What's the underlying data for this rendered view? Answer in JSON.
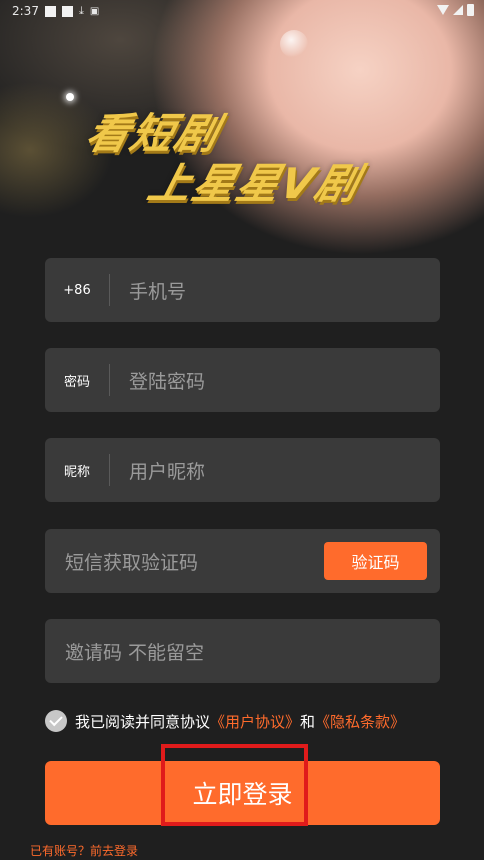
{
  "status_bar": {
    "time": "2:37"
  },
  "hero": {
    "slogan_line1": "看短剧",
    "slogan_line2": "上星星V剧"
  },
  "form": {
    "phone": {
      "prefix": "+86",
      "placeholder": "手机号"
    },
    "password": {
      "prefix": "密码",
      "placeholder": "登陆密码"
    },
    "nickname": {
      "prefix": "昵称",
      "placeholder": "用户昵称"
    },
    "sms": {
      "placeholder": "短信获取验证码",
      "button_label": "验证码"
    },
    "invite": {
      "placeholder": "邀请码 不能留空"
    }
  },
  "agreement": {
    "checked": true,
    "text": "我已阅读并同意协议",
    "user_agreement": "《用户协议》",
    "and": "和",
    "privacy_policy": "《隐私条款》"
  },
  "login_button": "立即登录",
  "has_account_link": "已有账号？前去登录",
  "colors": {
    "accent": "#ff6b2c",
    "field_bg": "#3a3a3a",
    "page_bg": "#1f1f1f",
    "slogan": "#f0c84a"
  }
}
